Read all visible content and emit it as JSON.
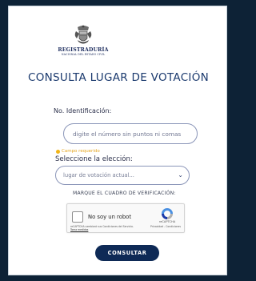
{
  "logo": {
    "title": "REGISTRADURÍA",
    "subtitle": "NACIONAL DEL ESTADO CIVIL",
    "icon": "coat-of-arms-icon"
  },
  "page_title": "CONSULTA LUGAR DE VOTACIÓN",
  "form": {
    "id_label": "No. Identificación:",
    "id_placeholder": "digite el número sin puntos ni comas",
    "required_hint": "Campo requerido",
    "election_label": "Seleccione la elección:",
    "election_value": "lugar de votación actual...",
    "captcha_hint": "MARQUE EL CUADRO DE VERIFICACIÓN:",
    "submit_label": "CONSULTAR"
  },
  "recaptcha": {
    "label": "No soy un robot",
    "fine_print": "reCAPTCHA cambiará sus Condiciones del Servicio.",
    "fine_link": "Toma medidas",
    "brand": "reCAPTCHA",
    "terms": "Privacidad - Condiciones"
  },
  "colors": {
    "background": "#0d2236",
    "title": "#1b3a6e",
    "button": "#0e2a56",
    "required": "#f2b518"
  }
}
